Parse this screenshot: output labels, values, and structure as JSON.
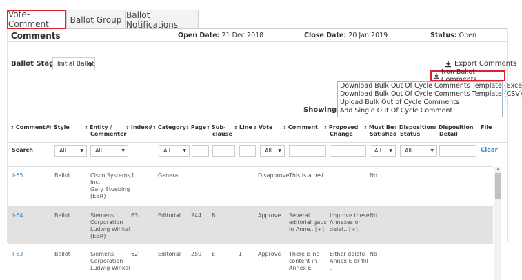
{
  "tabs": [
    {
      "label": "Vote-Comment"
    },
    {
      "label": "Ballot Group"
    },
    {
      "label": "Ballot Notifications"
    }
  ],
  "header": {
    "title": "Comments",
    "open_label": "Open Date:",
    "open_value": "21 Dec 2018",
    "close_label": "Close Date:",
    "close_value": "20 Jan 2019",
    "status_label": "Status:",
    "status_value": "Open"
  },
  "ballot_stage": {
    "label": "Ballot Stage:",
    "selected": "Initial Ballot"
  },
  "actions": {
    "export_comments": "Export Comments",
    "non_ballot_comments": "Non-Ballot Comments",
    "menu_items": [
      "Download Bulk Out Of Cycle Comments Template (Excel)",
      "Download Bulk Out Of Cycle Comments Template (CSV)",
      "Upload Bulk Out of Cycle Comments",
      "Add Single Out Of Cycle Comment"
    ],
    "showing": "Showing 1-"
  },
  "table": {
    "columns": {
      "comment": "Comment#",
      "style": "Style",
      "entity_line1": "Entity /",
      "entity_line2": "Commenter",
      "index": "Index#",
      "category": "Category",
      "page": "Page",
      "subclause_line1": "Sub-",
      "subclause_line2": "clause",
      "line": "Line",
      "vote": "Vote",
      "comment_text": "Comment",
      "proposed_line1": "Proposed",
      "proposed_line2": "Change",
      "mustbe_line1": "Must Be",
      "mustbe_line2": "Satisfied",
      "disp_status_line1": "Disposition",
      "disp_status_line2": "Status",
      "disp_detail_line1": "Disposition",
      "disp_detail_line2": "Detail",
      "file": "File"
    },
    "search_label": "Search",
    "filter_all": "All",
    "clear": "Clear",
    "rows": [
      {
        "id": "I-65",
        "style": "Ballot",
        "entity": [
          "Cisco Systems,",
          "Inc.",
          "Gary Stuebing",
          "(EBR)"
        ],
        "index": "1",
        "category": "General",
        "page": "",
        "subclause": "",
        "line": "",
        "vote": "Disapprove",
        "comment": [
          "This is a test"
        ],
        "proposed": [],
        "must_be": "No"
      },
      {
        "id": "I-64",
        "style": "Ballot",
        "entity": [
          "Siemens",
          "Corporation",
          "Ludwig Winkel",
          "(EBR)"
        ],
        "index": "63",
        "category": "Editorial",
        "page": "244",
        "subclause": "B",
        "line": "",
        "vote": "Approve",
        "comment": [
          "Several",
          "editorial gaps",
          "in Anne..."
        ],
        "proposed": [
          "Improve these",
          "Annexes or",
          "delet..."
        ],
        "must_be": "No",
        "more": "[+]"
      },
      {
        "id": "I-63",
        "style": "Ballot",
        "entity": [
          "Siemens",
          "Corporation",
          "Ludwig Winkel"
        ],
        "index": "62",
        "category": "Editorial",
        "page": "250",
        "subclause": "E",
        "line": "1",
        "vote": "Approve",
        "comment": [
          "There is no",
          "content in",
          "Annex E"
        ],
        "proposed": [
          "Either delete",
          "Annex E or fill",
          "..."
        ],
        "must_be": "No"
      }
    ]
  },
  "colors": {
    "highlight_border": "#d9232e",
    "link": "#3b86c6",
    "selected_row": "#e2e2e2"
  }
}
